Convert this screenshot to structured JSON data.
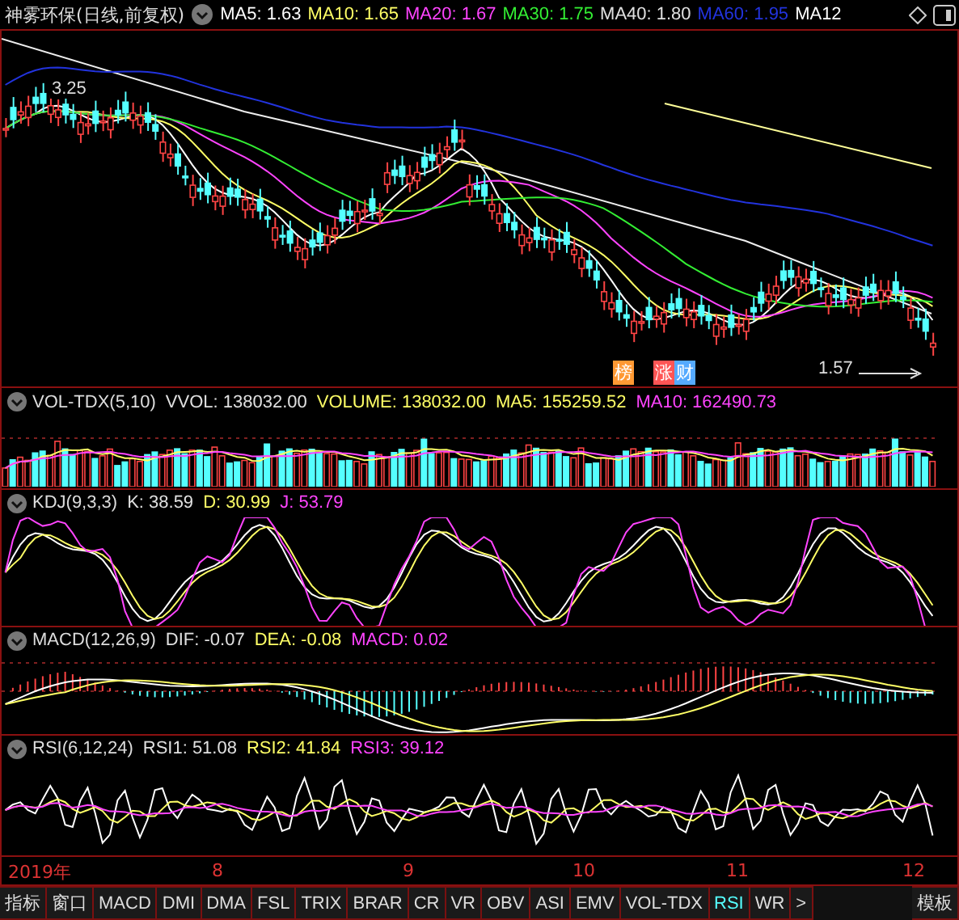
{
  "header": {
    "title": "神雾环保(日线,前复权)",
    "ma_labels": [
      {
        "text": "MA5: 1.63",
        "color": "#ffffff"
      },
      {
        "text": "MA10: 1.65",
        "color": "#ffff66"
      },
      {
        "text": "MA20: 1.67",
        "color": "#ff44ff"
      },
      {
        "text": "MA30: 1.75",
        "color": "#33ee33"
      },
      {
        "text": "MA40: 1.80",
        "color": "#e0e0e0"
      },
      {
        "text": "MA60: 1.95",
        "color": "#2233dd"
      },
      {
        "text": "MA12",
        "color": "#ffffff"
      }
    ]
  },
  "price_chart": {
    "high_label": "3.25",
    "low_label": "1.57",
    "badges": [
      {
        "text": "榜",
        "color": "#ff9933"
      },
      {
        "text": "涨",
        "color": "#ff5555"
      },
      {
        "text": "财",
        "color": "#55aaff"
      }
    ]
  },
  "panels": [
    {
      "kind": "vol",
      "name": "VOL-TDX(5,10)",
      "values": [
        {
          "text": "VVOL: 138032.00",
          "color": "#e0e0e0"
        },
        {
          "text": "VOLUME: 138032.00",
          "color": "#ffff66"
        },
        {
          "text": "MA5: 155259.52",
          "color": "#ffff66"
        },
        {
          "text": "MA10: 162490.73",
          "color": "#ff44ff"
        }
      ]
    },
    {
      "kind": "kdj",
      "name": "KDJ(9,3,3)",
      "values": [
        {
          "text": "K: 38.59",
          "color": "#e0e0e0"
        },
        {
          "text": "D: 30.99",
          "color": "#ffff66"
        },
        {
          "text": "J: 53.79",
          "color": "#ff44ff"
        }
      ]
    },
    {
      "kind": "macd",
      "name": "MACD(12,26,9)",
      "values": [
        {
          "text": "DIF: -0.07",
          "color": "#e0e0e0"
        },
        {
          "text": "DEA: -0.08",
          "color": "#ffff66"
        },
        {
          "text": "MACD: 0.02",
          "color": "#ff44ff"
        }
      ]
    },
    {
      "kind": "rsi",
      "name": "RSI(6,12,24)",
      "values": [
        {
          "text": "RSI1: 51.08",
          "color": "#e0e0e0"
        },
        {
          "text": "RSI2: 41.84",
          "color": "#ffff66"
        },
        {
          "text": "RSI3: 39.12",
          "color": "#ff44ff"
        }
      ]
    }
  ],
  "time_axis": [
    "2019年",
    "8",
    "9",
    "10",
    "11",
    "12"
  ],
  "left_buttons": [
    "指标",
    "窗口"
  ],
  "tabs": [
    {
      "label": "MACD",
      "selected": false
    },
    {
      "label": "DMI",
      "selected": false
    },
    {
      "label": "DMA",
      "selected": false
    },
    {
      "label": "FSL",
      "selected": false
    },
    {
      "label": "TRIX",
      "selected": false
    },
    {
      "label": "BRAR",
      "selected": false
    },
    {
      "label": "CR",
      "selected": false
    },
    {
      "label": "VR",
      "selected": false
    },
    {
      "label": "OBV",
      "selected": false
    },
    {
      "label": "ASI",
      "selected": false
    },
    {
      "label": "EMV",
      "selected": false
    },
    {
      "label": "VOL-TDX",
      "selected": false
    },
    {
      "label": "RSI",
      "selected": true
    },
    {
      "label": "WR",
      "selected": false
    }
  ],
  "more_button": ">",
  "right_button": "模板"
}
